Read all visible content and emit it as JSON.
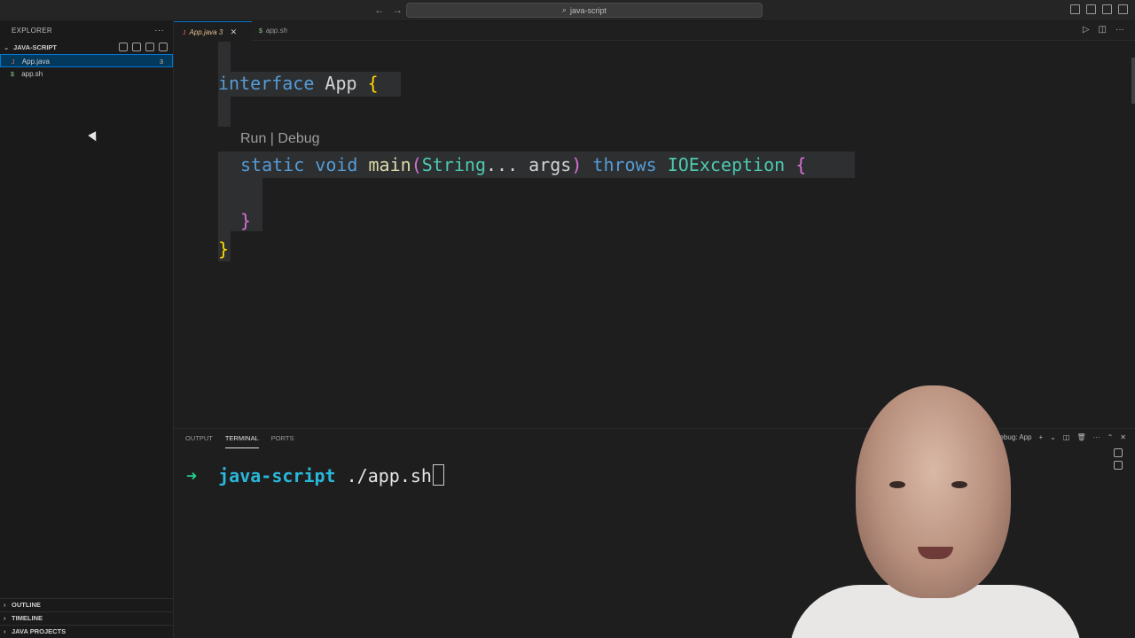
{
  "titlebar": {
    "back_icon": "arrow-left-icon",
    "forward_icon": "arrow-right-icon",
    "search_icon": "search-icon",
    "command_center": "java-script"
  },
  "sidebar": {
    "header": "EXPLORER",
    "more": "···",
    "folder": "JAVA-SCRIPT",
    "files": [
      {
        "name": "App.java",
        "icon": "J",
        "badge": "3",
        "selected": true
      },
      {
        "name": "app.sh",
        "icon": "$",
        "badge": "",
        "selected": false
      }
    ],
    "sections": [
      "OUTLINE",
      "TIMELINE",
      "JAVA PROJECTS"
    ]
  },
  "tabs": [
    {
      "icon": "J",
      "label": "App.java",
      "badge": "3",
      "close": "✕"
    },
    {
      "icon": "$",
      "label": "app.sh"
    }
  ],
  "editor": {
    "line1": {
      "kw": "interface",
      "name": "App",
      "brace": "{"
    },
    "codelens": "Run | Debug",
    "line2": {
      "static": "static",
      "void": "void",
      "fn": "main",
      "open": "(",
      "type": "String",
      "rest": "... args",
      "close": ")",
      "throws": "throws",
      "exc": "IOException",
      "brace": "{"
    },
    "inner_close": "}",
    "outer_close": "}"
  },
  "panel": {
    "tabs": [
      "OUTPUT",
      "TERMINAL",
      "PORTS"
    ],
    "active_tab": "TERMINAL",
    "session": "Debug: App",
    "terminal": {
      "arrow": "➜",
      "dir": "java-script",
      "command": "./app.sh"
    }
  },
  "colors": {
    "accent": "#0078d4",
    "keyword": "#569cd6",
    "brace_gold": "#ffd700",
    "brace_purple": "#da70d6",
    "prompt_green": "#23d18b",
    "prompt_cyan": "#29b8db"
  }
}
